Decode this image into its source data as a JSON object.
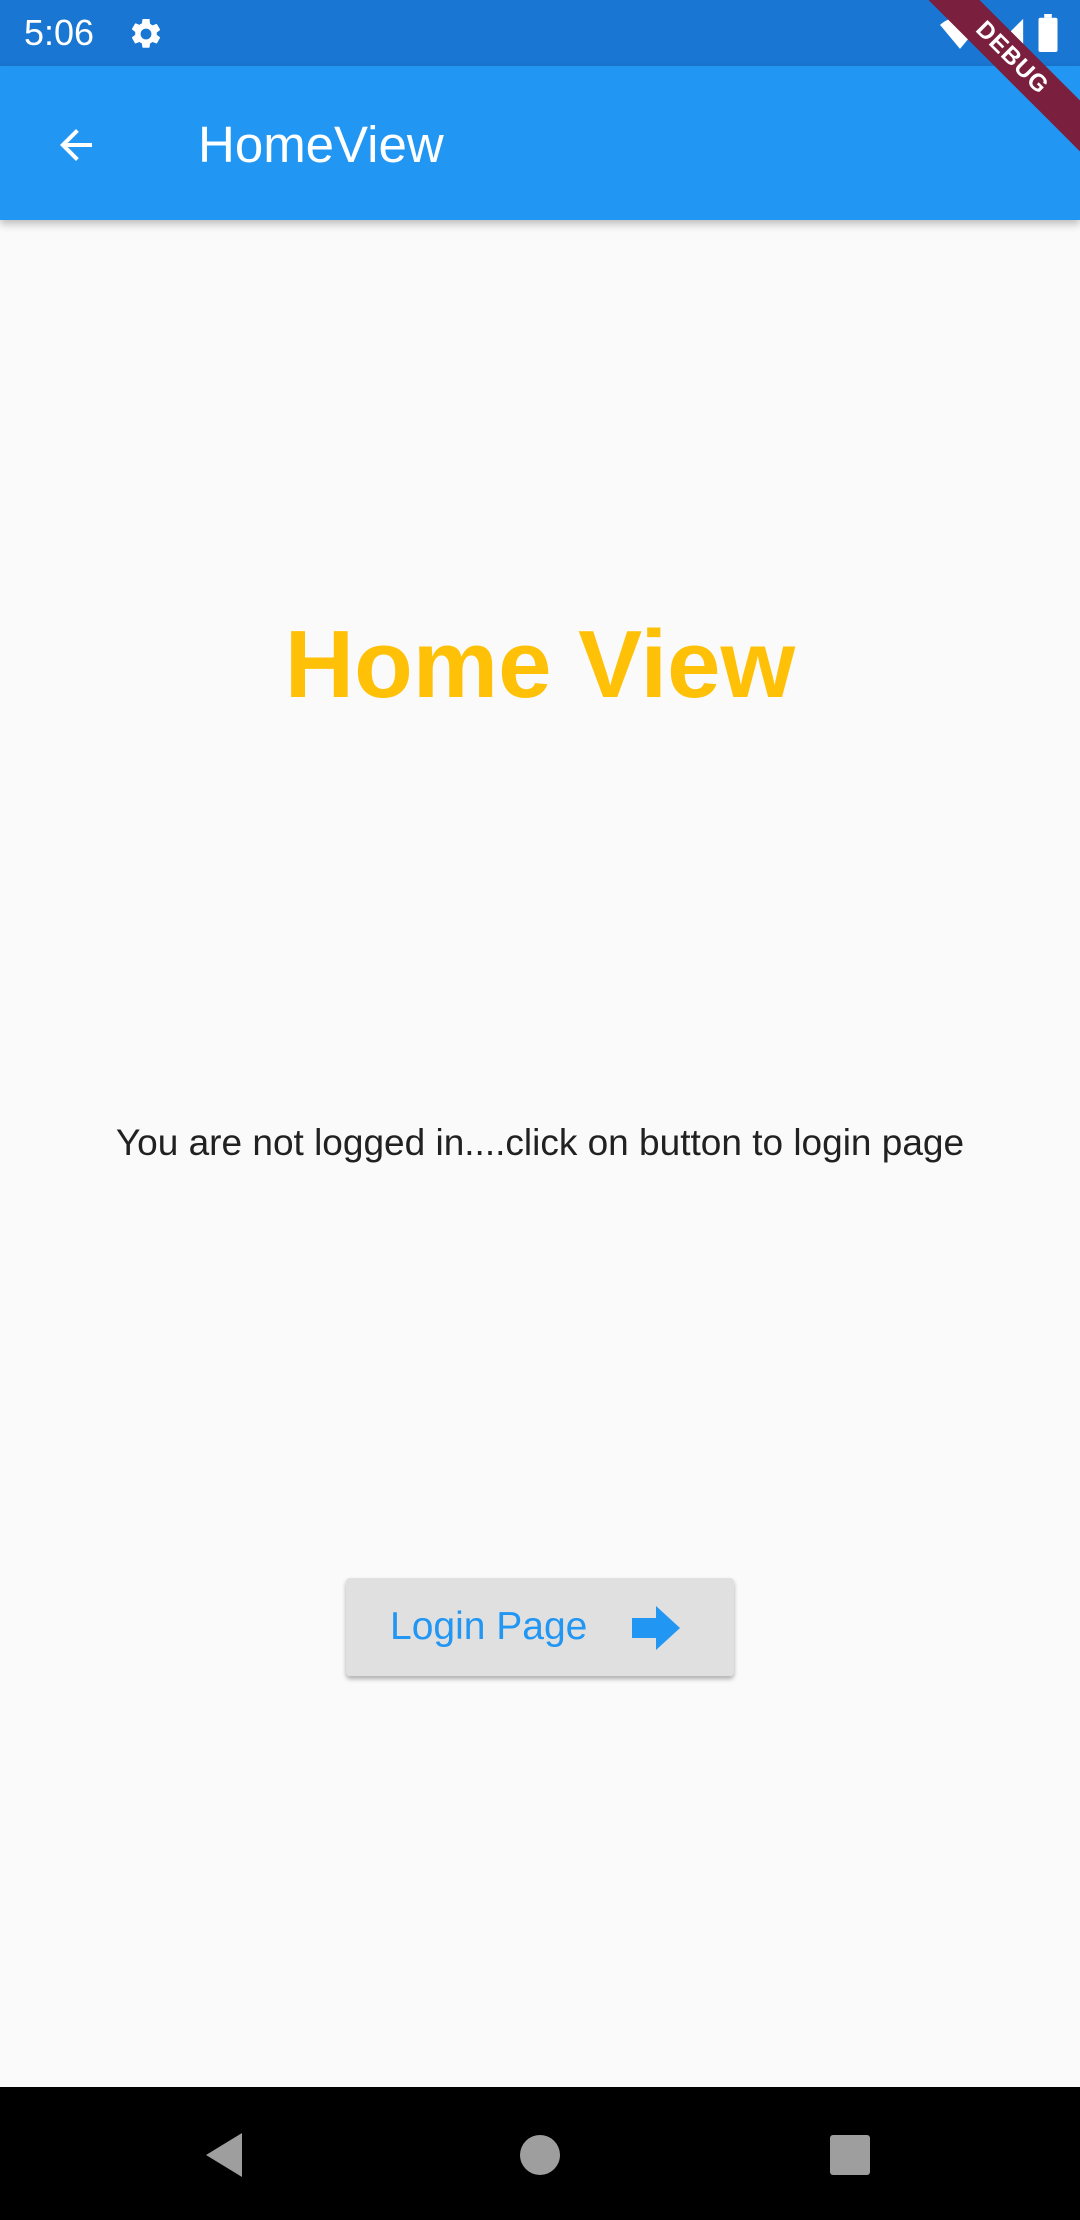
{
  "status_bar": {
    "time": "5:06",
    "icons": [
      "settings-icon",
      "wifi-icon",
      "signal-icon",
      "battery-icon"
    ]
  },
  "debug_banner": {
    "label": "DEBUG",
    "color": "#7a1f3d"
  },
  "app_bar": {
    "title": "HomeView",
    "back_icon": "arrow-back-icon",
    "background_color": "#2196f3",
    "status_bar_color": "#1976d2"
  },
  "main": {
    "heading": "Home View",
    "heading_color": "#ffc107",
    "message": "You are not logged in....click on button to login page",
    "login_button": {
      "label": "Login Page",
      "icon": "arrow-forward-icon",
      "text_color": "#2196f3",
      "background_color": "#e0e0e0"
    }
  },
  "navigation_bar": {
    "items": [
      "back-triangle-icon",
      "home-circle-icon",
      "recents-square-icon"
    ]
  }
}
